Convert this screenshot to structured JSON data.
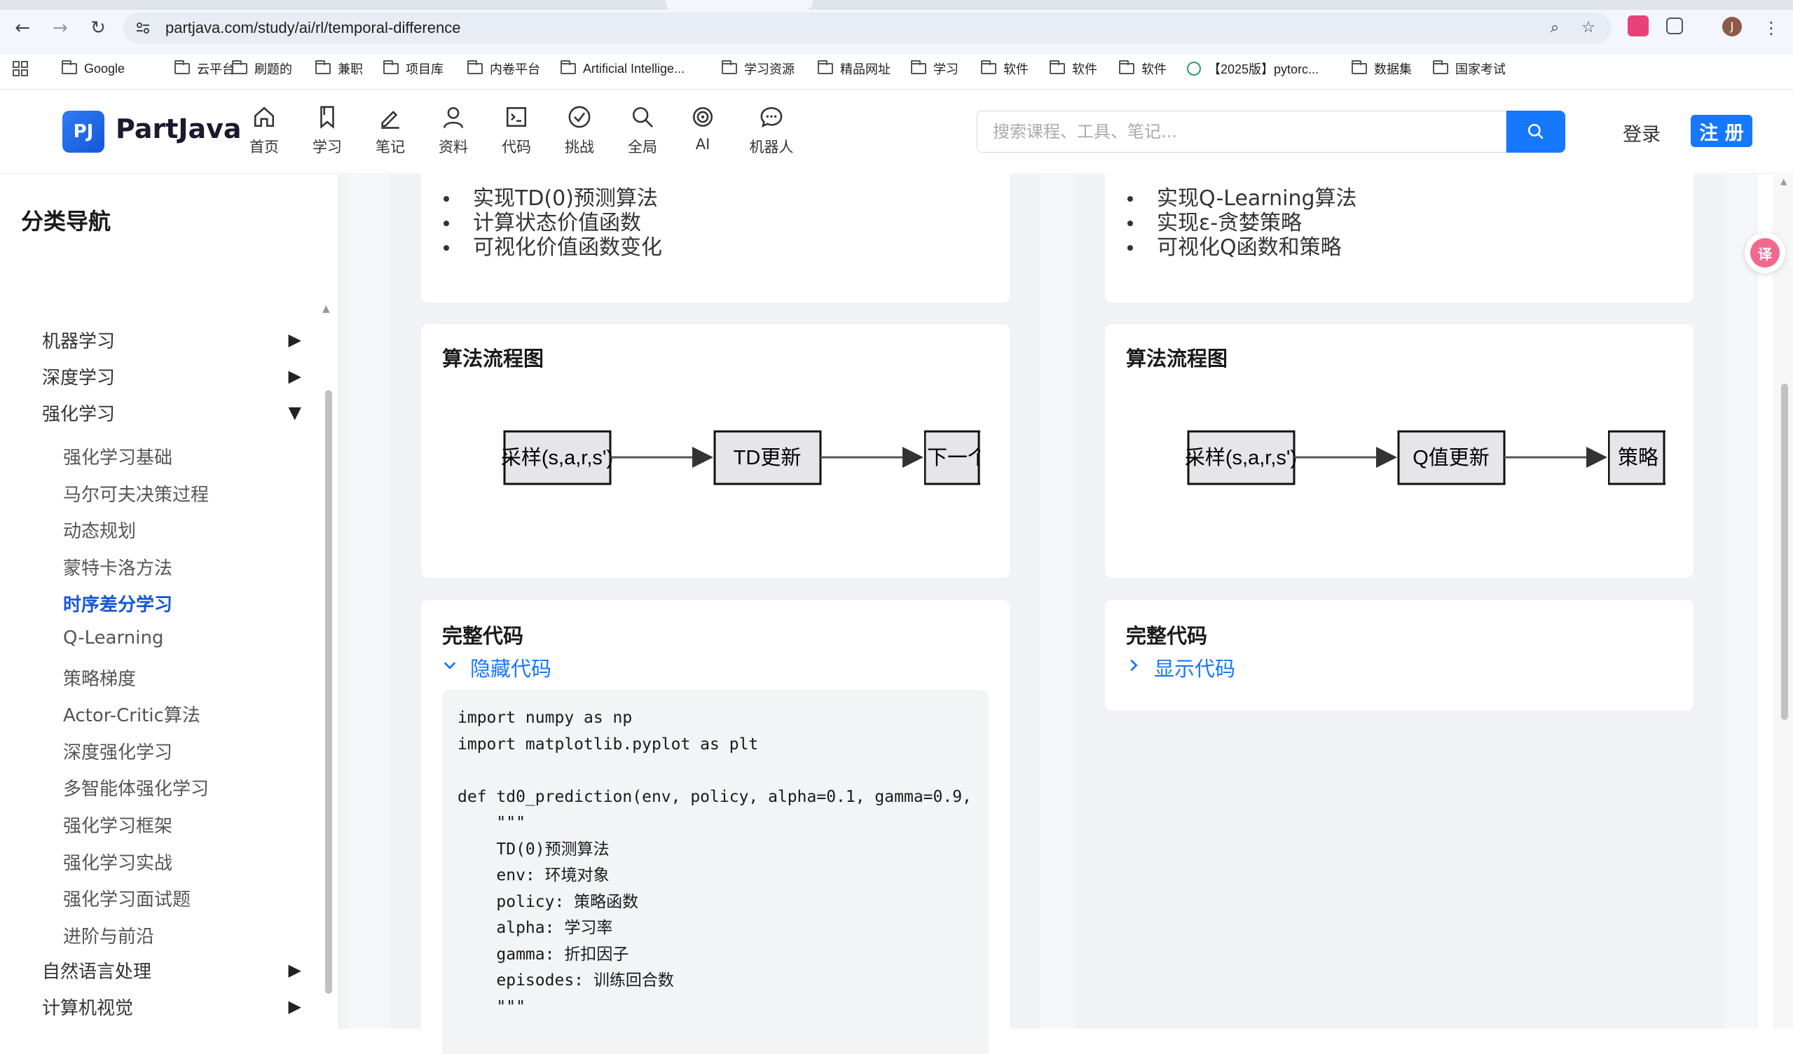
{
  "browser": {
    "url": "partjava.com/study/ai/rl/temporal-difference",
    "bookmarks": [
      "Google",
      "云平台",
      "刷题的",
      "兼职",
      "项目库",
      "内卷平台",
      "Artificial Intellige...",
      "学习资源",
      "精品网址",
      "学习",
      "软件",
      "软件",
      "软件",
      "【2025版】pytorc...",
      "数据集",
      "国家考试"
    ],
    "profile_initial": "J"
  },
  "header": {
    "logo_mark": "PJ",
    "logo_text": "PartJava",
    "nav": [
      {
        "label": "首页",
        "icon": "home-icon"
      },
      {
        "label": "学习",
        "icon": "bookmark-icon"
      },
      {
        "label": "笔记",
        "icon": "pen-icon"
      },
      {
        "label": "资料",
        "icon": "user-icon"
      },
      {
        "label": "代码",
        "icon": "terminal-icon"
      },
      {
        "label": "挑战",
        "icon": "check-circle-icon"
      },
      {
        "label": "全局",
        "icon": "search-icon"
      },
      {
        "label": "AI",
        "icon": "target-icon"
      },
      {
        "label": "机器人",
        "icon": "chat-icon"
      }
    ],
    "search_placeholder": "搜索课程、工具、笔记...",
    "login_label": "登录",
    "register_label": "注 册"
  },
  "sidebar": {
    "title": "分类导航",
    "categories": [
      {
        "label": "机器学习",
        "state": "collapsed"
      },
      {
        "label": "深度学习",
        "state": "collapsed"
      },
      {
        "label": "强化学习",
        "state": "expanded"
      },
      {
        "label": "自然语言处理",
        "state": "collapsed"
      },
      {
        "label": "计算机视觉",
        "state": "collapsed"
      }
    ],
    "rl_items": [
      "强化学习基础",
      "马尔可夫决策过程",
      "动态规划",
      "蒙特卡洛方法",
      "时序差分学习",
      "Q-Learning",
      "策略梯度",
      "Actor-Critic算法",
      "深度强化学习",
      "多智能体强化学习",
      "强化学习框架",
      "强化学习实战",
      "强化学习面试题",
      "进阶与前沿"
    ],
    "active_item": "时序差分学习"
  },
  "left_column": {
    "tasks": [
      "实现TD(0)预测算法",
      "计算状态价值函数",
      "可视化价值函数变化"
    ],
    "flow_title": "算法流程图",
    "flow_nodes": [
      "采样(s,a,r,s')",
      "TD更新",
      "下一个"
    ],
    "code_title": "完整代码",
    "code_toggle": "隐藏代码",
    "code_lines": [
      "import numpy as np",
      "import matplotlib.pyplot as plt",
      "",
      "def td0_prediction(env, policy, alpha=0.1, gamma=0.9,",
      "    \"\"\"",
      "    TD(0)预测算法",
      "    env: 环境对象",
      "    policy: 策略函数",
      "    alpha: 学习率",
      "    gamma: 折扣因子",
      "    episodes: 训练回合数",
      "    \"\"\""
    ]
  },
  "right_column": {
    "tasks": [
      "实现Q-Learning算法",
      "实现ε-贪婪策略",
      "可视化Q函数和策略"
    ],
    "flow_title": "算法流程图",
    "flow_nodes": [
      "采样(s,a,r,s')",
      "Q值更新",
      "策略"
    ],
    "code_title": "完整代码",
    "code_toggle": "显示代码"
  },
  "colors": {
    "accent": "#1677ff",
    "active_link": "#1557d6",
    "flow_node_fill": "#e6e6e9"
  }
}
